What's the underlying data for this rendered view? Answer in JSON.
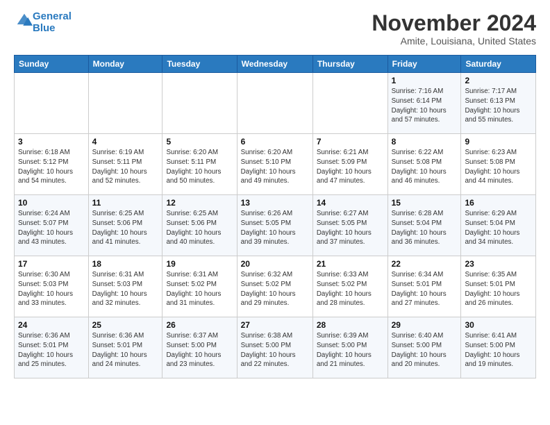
{
  "header": {
    "logo_line1": "General",
    "logo_line2": "Blue",
    "month": "November 2024",
    "location": "Amite, Louisiana, United States"
  },
  "weekdays": [
    "Sunday",
    "Monday",
    "Tuesday",
    "Wednesday",
    "Thursday",
    "Friday",
    "Saturday"
  ],
  "weeks": [
    [
      {
        "day": "",
        "info": ""
      },
      {
        "day": "",
        "info": ""
      },
      {
        "day": "",
        "info": ""
      },
      {
        "day": "",
        "info": ""
      },
      {
        "day": "",
        "info": ""
      },
      {
        "day": "1",
        "info": "Sunrise: 7:16 AM\nSunset: 6:14 PM\nDaylight: 10 hours\nand 57 minutes."
      },
      {
        "day": "2",
        "info": "Sunrise: 7:17 AM\nSunset: 6:13 PM\nDaylight: 10 hours\nand 55 minutes."
      }
    ],
    [
      {
        "day": "3",
        "info": "Sunrise: 6:18 AM\nSunset: 5:12 PM\nDaylight: 10 hours\nand 54 minutes."
      },
      {
        "day": "4",
        "info": "Sunrise: 6:19 AM\nSunset: 5:11 PM\nDaylight: 10 hours\nand 52 minutes."
      },
      {
        "day": "5",
        "info": "Sunrise: 6:20 AM\nSunset: 5:11 PM\nDaylight: 10 hours\nand 50 minutes."
      },
      {
        "day": "6",
        "info": "Sunrise: 6:20 AM\nSunset: 5:10 PM\nDaylight: 10 hours\nand 49 minutes."
      },
      {
        "day": "7",
        "info": "Sunrise: 6:21 AM\nSunset: 5:09 PM\nDaylight: 10 hours\nand 47 minutes."
      },
      {
        "day": "8",
        "info": "Sunrise: 6:22 AM\nSunset: 5:08 PM\nDaylight: 10 hours\nand 46 minutes."
      },
      {
        "day": "9",
        "info": "Sunrise: 6:23 AM\nSunset: 5:08 PM\nDaylight: 10 hours\nand 44 minutes."
      }
    ],
    [
      {
        "day": "10",
        "info": "Sunrise: 6:24 AM\nSunset: 5:07 PM\nDaylight: 10 hours\nand 43 minutes."
      },
      {
        "day": "11",
        "info": "Sunrise: 6:25 AM\nSunset: 5:06 PM\nDaylight: 10 hours\nand 41 minutes."
      },
      {
        "day": "12",
        "info": "Sunrise: 6:25 AM\nSunset: 5:06 PM\nDaylight: 10 hours\nand 40 minutes."
      },
      {
        "day": "13",
        "info": "Sunrise: 6:26 AM\nSunset: 5:05 PM\nDaylight: 10 hours\nand 39 minutes."
      },
      {
        "day": "14",
        "info": "Sunrise: 6:27 AM\nSunset: 5:05 PM\nDaylight: 10 hours\nand 37 minutes."
      },
      {
        "day": "15",
        "info": "Sunrise: 6:28 AM\nSunset: 5:04 PM\nDaylight: 10 hours\nand 36 minutes."
      },
      {
        "day": "16",
        "info": "Sunrise: 6:29 AM\nSunset: 5:04 PM\nDaylight: 10 hours\nand 34 minutes."
      }
    ],
    [
      {
        "day": "17",
        "info": "Sunrise: 6:30 AM\nSunset: 5:03 PM\nDaylight: 10 hours\nand 33 minutes."
      },
      {
        "day": "18",
        "info": "Sunrise: 6:31 AM\nSunset: 5:03 PM\nDaylight: 10 hours\nand 32 minutes."
      },
      {
        "day": "19",
        "info": "Sunrise: 6:31 AM\nSunset: 5:02 PM\nDaylight: 10 hours\nand 31 minutes."
      },
      {
        "day": "20",
        "info": "Sunrise: 6:32 AM\nSunset: 5:02 PM\nDaylight: 10 hours\nand 29 minutes."
      },
      {
        "day": "21",
        "info": "Sunrise: 6:33 AM\nSunset: 5:02 PM\nDaylight: 10 hours\nand 28 minutes."
      },
      {
        "day": "22",
        "info": "Sunrise: 6:34 AM\nSunset: 5:01 PM\nDaylight: 10 hours\nand 27 minutes."
      },
      {
        "day": "23",
        "info": "Sunrise: 6:35 AM\nSunset: 5:01 PM\nDaylight: 10 hours\nand 26 minutes."
      }
    ],
    [
      {
        "day": "24",
        "info": "Sunrise: 6:36 AM\nSunset: 5:01 PM\nDaylight: 10 hours\nand 25 minutes."
      },
      {
        "day": "25",
        "info": "Sunrise: 6:36 AM\nSunset: 5:01 PM\nDaylight: 10 hours\nand 24 minutes."
      },
      {
        "day": "26",
        "info": "Sunrise: 6:37 AM\nSunset: 5:00 PM\nDaylight: 10 hours\nand 23 minutes."
      },
      {
        "day": "27",
        "info": "Sunrise: 6:38 AM\nSunset: 5:00 PM\nDaylight: 10 hours\nand 22 minutes."
      },
      {
        "day": "28",
        "info": "Sunrise: 6:39 AM\nSunset: 5:00 PM\nDaylight: 10 hours\nand 21 minutes."
      },
      {
        "day": "29",
        "info": "Sunrise: 6:40 AM\nSunset: 5:00 PM\nDaylight: 10 hours\nand 20 minutes."
      },
      {
        "day": "30",
        "info": "Sunrise: 6:41 AM\nSunset: 5:00 PM\nDaylight: 10 hours\nand 19 minutes."
      }
    ]
  ]
}
